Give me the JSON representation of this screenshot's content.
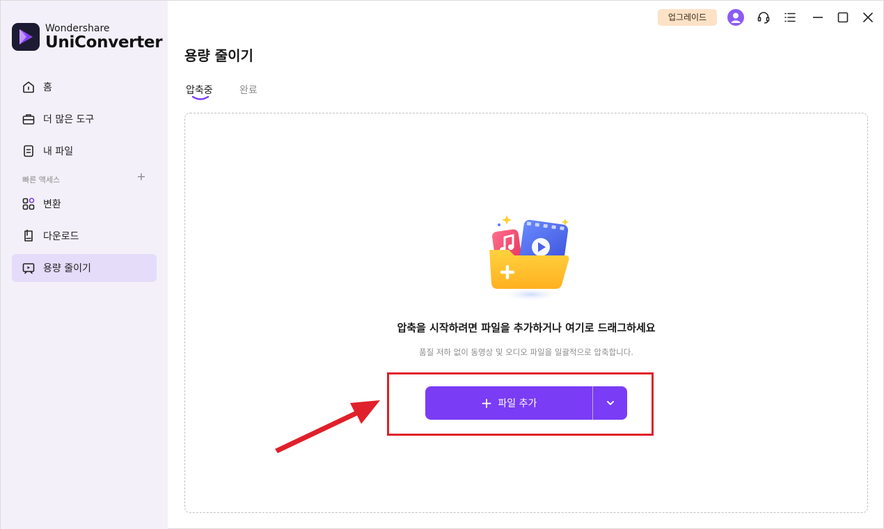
{
  "brand": {
    "sub": "Wondershare",
    "name": "UniConverter"
  },
  "sidebar": {
    "items": [
      {
        "label": "홈",
        "icon": "home-icon"
      },
      {
        "label": "더 많은 도구",
        "icon": "toolbox-icon"
      },
      {
        "label": "내 파일",
        "icon": "file-icon"
      }
    ],
    "quick_access_label": "빠른 액세스",
    "quick_items": [
      {
        "label": "변환",
        "icon": "convert-icon"
      },
      {
        "label": "다운로드",
        "icon": "download-icon"
      },
      {
        "label": "용량 줄이기",
        "icon": "compress-icon",
        "active": true
      }
    ]
  },
  "topbar": {
    "upgrade_label": "업그레이드",
    "icons": [
      "avatar-icon",
      "support-headset-icon",
      "menu-list-icon",
      "minimize-icon",
      "maximize-icon",
      "close-icon"
    ]
  },
  "main": {
    "title": "용량 줄이기",
    "tabs": [
      {
        "label": "압축중",
        "active": true
      },
      {
        "label": "완료",
        "active": false
      }
    ],
    "drop_title": "압축을 시작하려면 파일을 추가하거나 여기로 드래그하세요",
    "drop_subtitle": "품질 저하 없이 동영상 및 오디오 파일을 일괄적으로 압축합니다.",
    "add_button_label": "파일 추가"
  },
  "colors": {
    "accent": "#7a3cf5",
    "sidebar_bg": "#f3f0fa",
    "active_item_bg": "#e4dcf8",
    "upgrade_bg": "#fde2c6",
    "annotation_red": "#e0202a"
  }
}
